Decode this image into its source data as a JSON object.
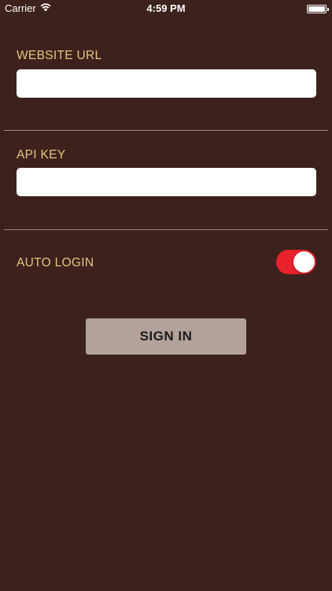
{
  "status_bar": {
    "carrier": "Carrier",
    "time": "4:59 PM",
    "wifi_icon": "wifi-icon",
    "battery_icon": "battery-icon"
  },
  "form": {
    "website_url": {
      "label": "WEBSITE URL",
      "value": "",
      "placeholder": ""
    },
    "api_key": {
      "label": "API KEY",
      "value": "",
      "placeholder": ""
    },
    "auto_login": {
      "label": "AUTO LOGIN",
      "enabled": true
    },
    "sign_in_label": "SIGN IN"
  },
  "colors": {
    "background": "#3d211c",
    "label": "#e6c57f",
    "toggle_on": "#e8222b",
    "button": "#b2a299"
  }
}
